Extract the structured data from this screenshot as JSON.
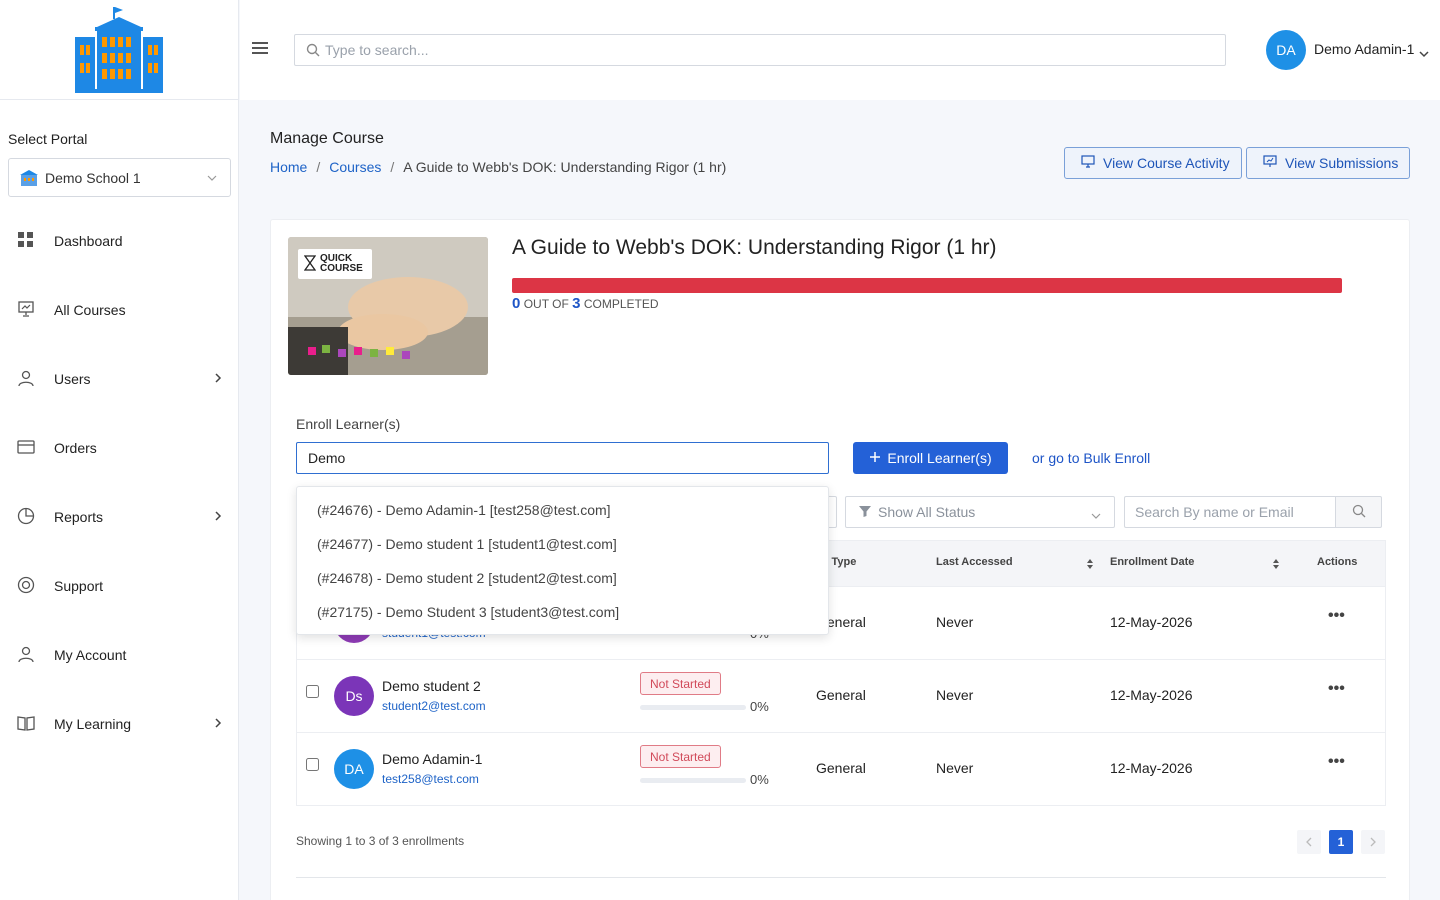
{
  "sidebar": {
    "select_portal_label": "Select Portal",
    "portal_value": "Demo School 1",
    "items": [
      {
        "label": "Dashboard",
        "icon": "dashboard-icon",
        "has_arrow": false
      },
      {
        "label": "All Courses",
        "icon": "courses-icon",
        "has_arrow": false
      },
      {
        "label": "Users",
        "icon": "user-icon",
        "has_arrow": true
      },
      {
        "label": "Orders",
        "icon": "card-icon",
        "has_arrow": false
      },
      {
        "label": "Reports",
        "icon": "pie-chart-icon",
        "has_arrow": true
      },
      {
        "label": "Support",
        "icon": "lifebuoy-icon",
        "has_arrow": false
      },
      {
        "label": "My Account",
        "icon": "user-icon",
        "has_arrow": false
      },
      {
        "label": "My Learning",
        "icon": "book-icon",
        "has_arrow": true
      }
    ]
  },
  "topbar": {
    "search_placeholder": "Type to search...",
    "user_initials": "DA",
    "user_name": "Demo Adamin-1"
  },
  "header": {
    "title": "Manage Course",
    "breadcrumb": [
      "Home",
      "Courses",
      "A Guide to Webb's DOK: Understanding Rigor (1 hr)"
    ],
    "view_activity_label": "View Course Activity",
    "view_submissions_label": "View Submissions"
  },
  "course": {
    "title": "A Guide to Webb's DOK: Understanding Rigor (1 hr)",
    "thumb_badge_line1": "QUICK",
    "thumb_badge_line2": "COURSE",
    "completed_count": "0",
    "out_of_label": "OUT OF",
    "total_count": "3",
    "completed_label": "COMPLETED",
    "progress_fraction": 0
  },
  "enroll": {
    "label": "Enroll Learner(s)",
    "input_value": "Demo",
    "button_label": "Enroll Learner(s)",
    "bulk_link": "or go to Bulk Enroll",
    "suggestions": [
      "(#24676) - Demo Adamin-1 [test258@test.com]",
      "(#24677) - Demo student 1 [student1@test.com]",
      "(#24678) - Demo student 2 [student2@test.com]",
      "(#27175) - Demo Student 3 [student3@test.com]"
    ]
  },
  "filters": {
    "status_placeholder": "Show All Status",
    "search_placeholder": "Search By name or Email"
  },
  "table": {
    "headers": {
      "user_type": "er Type",
      "last_accessed": "Last Accessed",
      "enrollment_date": "Enrollment Date",
      "actions": "Actions"
    },
    "rows": [
      {
        "initials": "",
        "name": "",
        "email": "student1@test.com",
        "status": "",
        "progress_pct": "0%",
        "progress": 0,
        "user_type": "General",
        "last_accessed": "Never",
        "enrollment_date": "12-May-2026",
        "avatar_color": "#8e3bb5"
      },
      {
        "initials": "Ds",
        "name": "Demo student 2",
        "email": "student2@test.com",
        "status": "Not Started",
        "progress_pct": "0%",
        "progress": 0,
        "user_type": "General",
        "last_accessed": "Never",
        "enrollment_date": "12-May-2026",
        "avatar_color": "#7b35b8"
      },
      {
        "initials": "DA",
        "name": "Demo Adamin-1",
        "email": "test258@test.com",
        "status": "Not Started",
        "progress_pct": "0%",
        "progress": 0,
        "user_type": "General",
        "last_accessed": "Never",
        "enrollment_date": "12-May-2026",
        "avatar_color": "#1e90e6"
      }
    ]
  },
  "footer": {
    "showing_text": "Showing 1 to 3 of 3 enrollments",
    "current_page": "1"
  },
  "colors": {
    "primary": "#2461d7",
    "progress_red": "#dc3545",
    "link_blue": "#1e63c7"
  }
}
